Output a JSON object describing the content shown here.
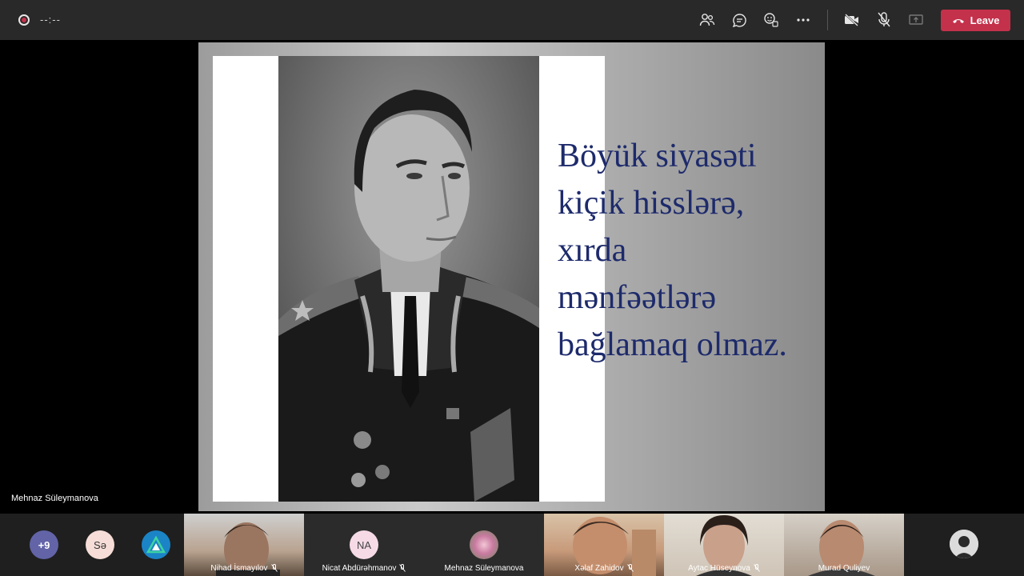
{
  "topbar": {
    "timer": "--:--",
    "leave_label": "Leave",
    "colors": {
      "bar": "#292929",
      "leave": "#c4314b"
    }
  },
  "slide": {
    "quote": "Böyük siyasəti\nkiçik hisslərə,\nxırda\nmənfəətlərə\nbağlamaq olmaz."
  },
  "presenter": {
    "name": "Mehnaz Süleymanova"
  },
  "participants": {
    "overflow_count": "+9",
    "initials_se": "Sə",
    "tiles": [
      {
        "name": "Nihad İsmayılov"
      },
      {
        "name": "Nicat Abdürəhmanov",
        "initials": "NA"
      },
      {
        "name": "Mehnaz Süleymanova"
      },
      {
        "name": "Xəlaf Zahidov"
      },
      {
        "name": "Aytac Hüseynova"
      },
      {
        "name": "Murad Quliyev"
      }
    ]
  }
}
